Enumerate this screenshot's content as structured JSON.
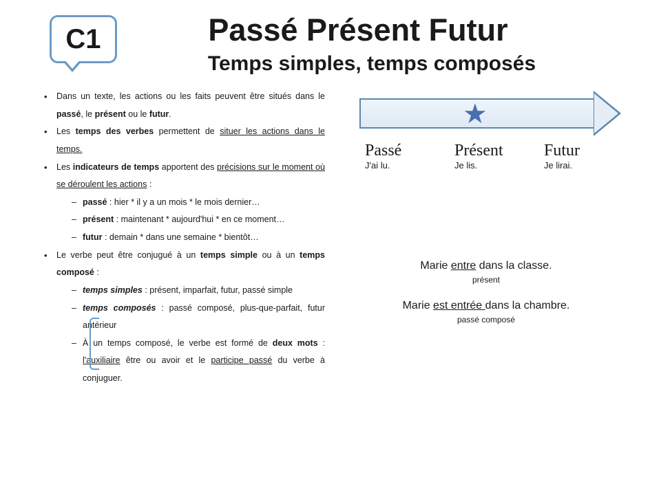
{
  "badge": "C1",
  "title": "Passé Présent Futur",
  "subtitle": "Temps simples, temps composés",
  "bullets": {
    "b1a": "Dans un texte, les actions ou les faits peuvent être situés dans le ",
    "b1b": "passé",
    "b1c": ", le ",
    "b1d": "présent",
    "b1e": " ou le ",
    "b1f": "futur",
    "b1g": ".",
    "b2a": "Les ",
    "b2b": "temps des verbes",
    "b2c": " permettent de ",
    "b2d": "situer les actions dans le temps.",
    "b3a": "Les ",
    "b3b": "indicateurs de temps",
    "b3c": " apportent des ",
    "b3d": "précisions sur le moment où se déroulent les actions",
    "b3e": " :",
    "b3_1a": "passé",
    "b3_1b": " : hier * il y a un mois * le mois dernier…",
    "b3_2a": "présent",
    "b3_2b": " : maintenant * aujourd'hui * en ce moment…",
    "b3_3a": "futur",
    "b3_3b": " : demain * dans une semaine * bientôt…",
    "b4a": "Le verbe peut être conjugué à un ",
    "b4b": "temps simple",
    "b4c": " ou à un ",
    "b4d": "temps composé",
    "b4e": " :",
    "b4_1a": "temps simples",
    "b4_1b": " : présent, imparfait, futur, passé simple",
    "b4_2a": "temps composés",
    "b4_2b": " : passé composé, plus-que-parfait, futur antérieur",
    "b4_3a": "À un temps composé, le verbe est formé de ",
    "b4_3b": "deux mots",
    "b4_3c": " : ",
    "b4_3d": "l'auxiliaire",
    "b4_3e": " être ou avoir et le ",
    "b4_3f": "participe passé",
    "b4_3g": " du verbe à conjuguer."
  },
  "timeline": {
    "t1": "Passé",
    "s1": "J'ai lu.",
    "t2": "Présent",
    "s2": "Je lis.",
    "t3": "Futur",
    "s3": "Je lirai."
  },
  "examples": {
    "e1a": "Marie ",
    "e1b": "entre",
    "e1c": " dans la classe.",
    "tag1": "présent",
    "e2a": "Marie ",
    "e2b": "est entrée ",
    "e2c": "dans la chambre.",
    "tag2": "passé composé"
  }
}
